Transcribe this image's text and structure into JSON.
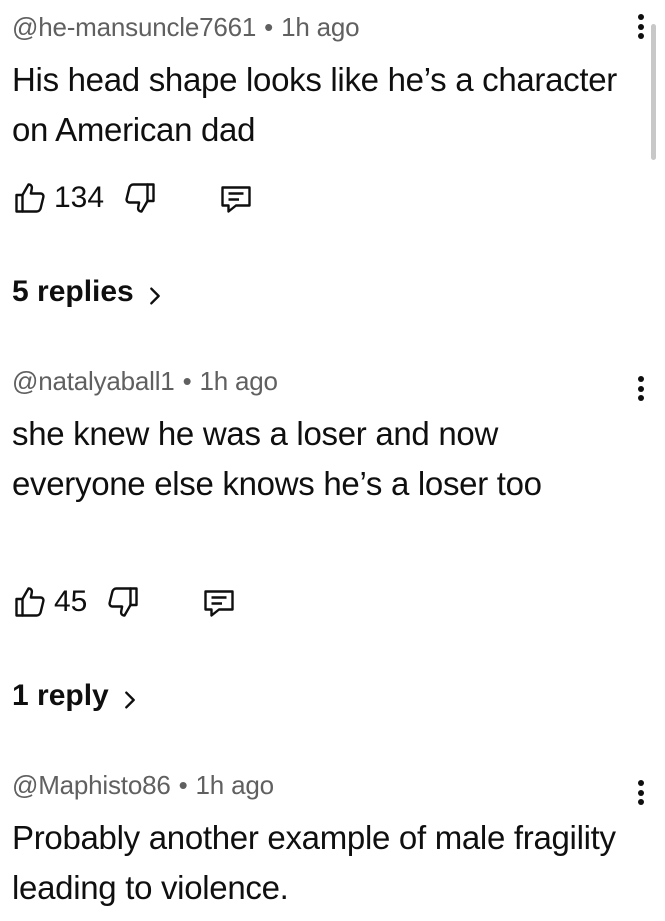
{
  "comments": [
    {
      "author": "@he-mansuncle7661",
      "separator": "•",
      "time": "1h ago",
      "text": "His head shape looks like he’s a character on American dad",
      "likes": "134",
      "replies_label": "5 replies"
    },
    {
      "author": "@natalyaball1",
      "separator": "•",
      "time": "1h ago",
      "text": "she knew he was a loser and now everyone else knows he’s a loser too",
      "likes": "45",
      "replies_label": "1 reply"
    },
    {
      "author": "@Maphisto86",
      "separator": "•",
      "time": "1h ago",
      "text": "Probably another example of male fragility leading to violence."
    }
  ],
  "icons": {
    "like": "thumbs-up-icon",
    "dislike": "thumbs-down-icon",
    "reply": "comment-icon",
    "menu": "more-vertical-icon",
    "expand": "chevron-right-icon"
  }
}
